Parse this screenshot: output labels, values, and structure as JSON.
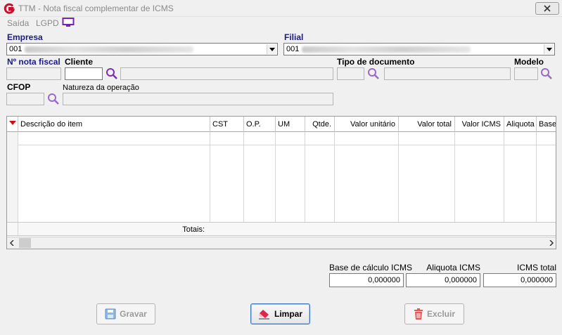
{
  "window": {
    "title": "TTM - Nota fiscal complementar de ICMS"
  },
  "menu": {
    "saida": "Saída",
    "lgpd": "LGPD"
  },
  "empresa": {
    "label": "Empresa",
    "value": "001"
  },
  "filial": {
    "label": "Filial",
    "value": "001"
  },
  "nota_fiscal": {
    "label": "Nº nota fiscal",
    "value": ""
  },
  "cliente": {
    "label": "Cliente",
    "code": "",
    "name": ""
  },
  "tipo_documento": {
    "label": "Tipo de documento",
    "code": "",
    "name": ""
  },
  "modelo": {
    "label": "Modelo",
    "value": ""
  },
  "cfop": {
    "label": "CFOP",
    "value": ""
  },
  "natureza": {
    "label": "Natureza da operação",
    "value": ""
  },
  "grid": {
    "columns": [
      "Descrição do item",
      "CST",
      "O.P.",
      "UM",
      "Qtde.",
      "Valor unitário",
      "Valor total",
      "Valor ICMS",
      "Aliquota",
      "Base"
    ],
    "totals_label": "Totais:"
  },
  "totals": {
    "base_label": "Base de cálculo ICMS",
    "base_value": "0,000000",
    "aliquota_label": "Aliquota ICMS",
    "aliquota_value": "0,000000",
    "icms_label": "ICMS total",
    "icms_value": "0,000000"
  },
  "buttons": {
    "gravar": "Gravar",
    "limpar": "Limpar",
    "excluir": "Excluir"
  },
  "colors": {
    "label_blue": "#1a1a8a",
    "search_icon": "#7a2fb5",
    "logo_red": "#c8102e",
    "monitor_purple": "#7a1fb0"
  }
}
